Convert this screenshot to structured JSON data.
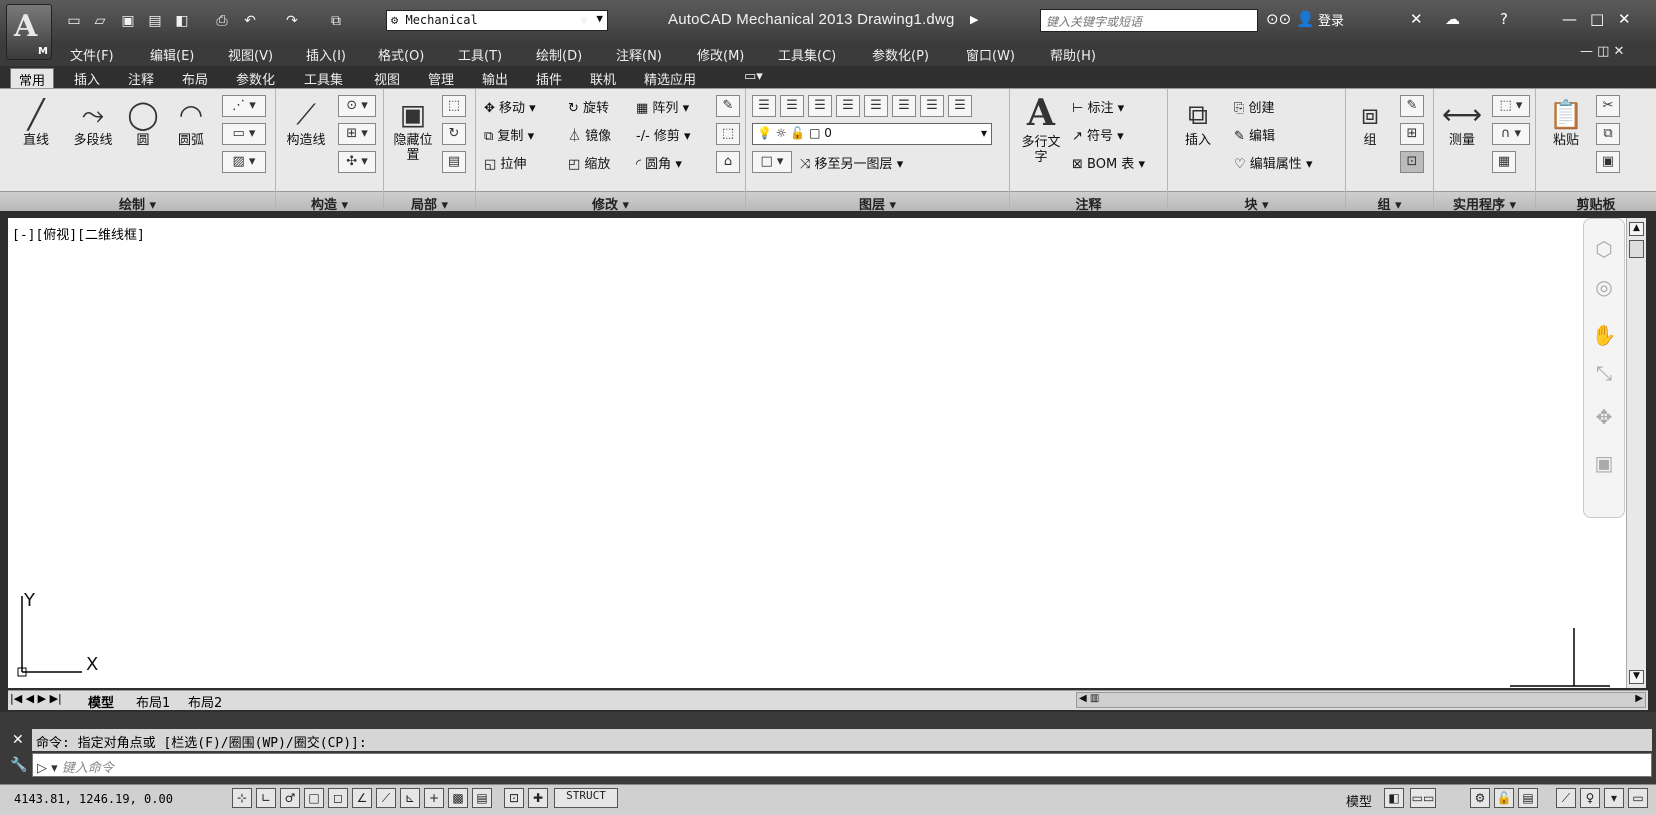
{
  "app": {
    "logo_letter": "A",
    "logo_sub": "M",
    "title": "AutoCAD Mechanical 2013    Drawing1.dwg",
    "workspace": "Mechanical",
    "search_placeholder": "键入关键字或短语",
    "login": "登录"
  },
  "menus": [
    "文件(F)",
    "编辑(E)",
    "视图(V)",
    "插入(I)",
    "格式(O)",
    "工具(T)",
    "绘制(D)",
    "注释(N)",
    "修改(M)",
    "工具集(C)",
    "参数化(P)",
    "窗口(W)",
    "帮助(H)"
  ],
  "ribbon_tabs": [
    "常用",
    "插入",
    "注释",
    "布局",
    "参数化",
    "工具集",
    "视图",
    "管理",
    "输出",
    "插件",
    "联机",
    "精选应用"
  ],
  "panels": {
    "draw": {
      "title": "绘制 ▾",
      "buttons": [
        "直线",
        "多段线",
        "圆",
        "圆弧"
      ]
    },
    "construct": {
      "title": "构造 ▾",
      "big": "构造线"
    },
    "detail": {
      "title": "局部 ▾",
      "big": "隐藏位置"
    },
    "modify": {
      "title": "修改 ▾",
      "items": [
        "移动",
        "旋转",
        "阵列",
        "复制",
        "镜像",
        "修剪",
        "拉伸",
        "缩放",
        "圆角"
      ]
    },
    "layers": {
      "title": "图层 ▾",
      "layer_value": "0",
      "move_to": "移至另一图层"
    },
    "annotation": {
      "title": "注释",
      "big": "多行文字",
      "items": [
        "标注",
        "符号",
        "BOM 表"
      ]
    },
    "block": {
      "title": "块 ▾",
      "big": "插入",
      "items": [
        "创建",
        "编辑",
        "编辑属性"
      ]
    },
    "group": {
      "title": "组 ▾",
      "big": "组"
    },
    "utilities": {
      "title": "实用程序 ▾",
      "big": "测量"
    },
    "clipboard": {
      "title": "剪贴板",
      "big": "粘贴"
    }
  },
  "view_label": "[-][俯视][二维线框]",
  "ucs": {
    "x": "X",
    "y": "Y"
  },
  "layout_tabs": [
    "模型",
    "布局1",
    "布局2"
  ],
  "command": {
    "history": "命令: 指定对角点或 [栏选(F)/圈围(WP)/圈交(CP)]:",
    "placeholder": "键入命令"
  },
  "status": {
    "coords": "4143.81, 1246.19, 0.00",
    "struct": "STRUCT",
    "model": "模型"
  }
}
